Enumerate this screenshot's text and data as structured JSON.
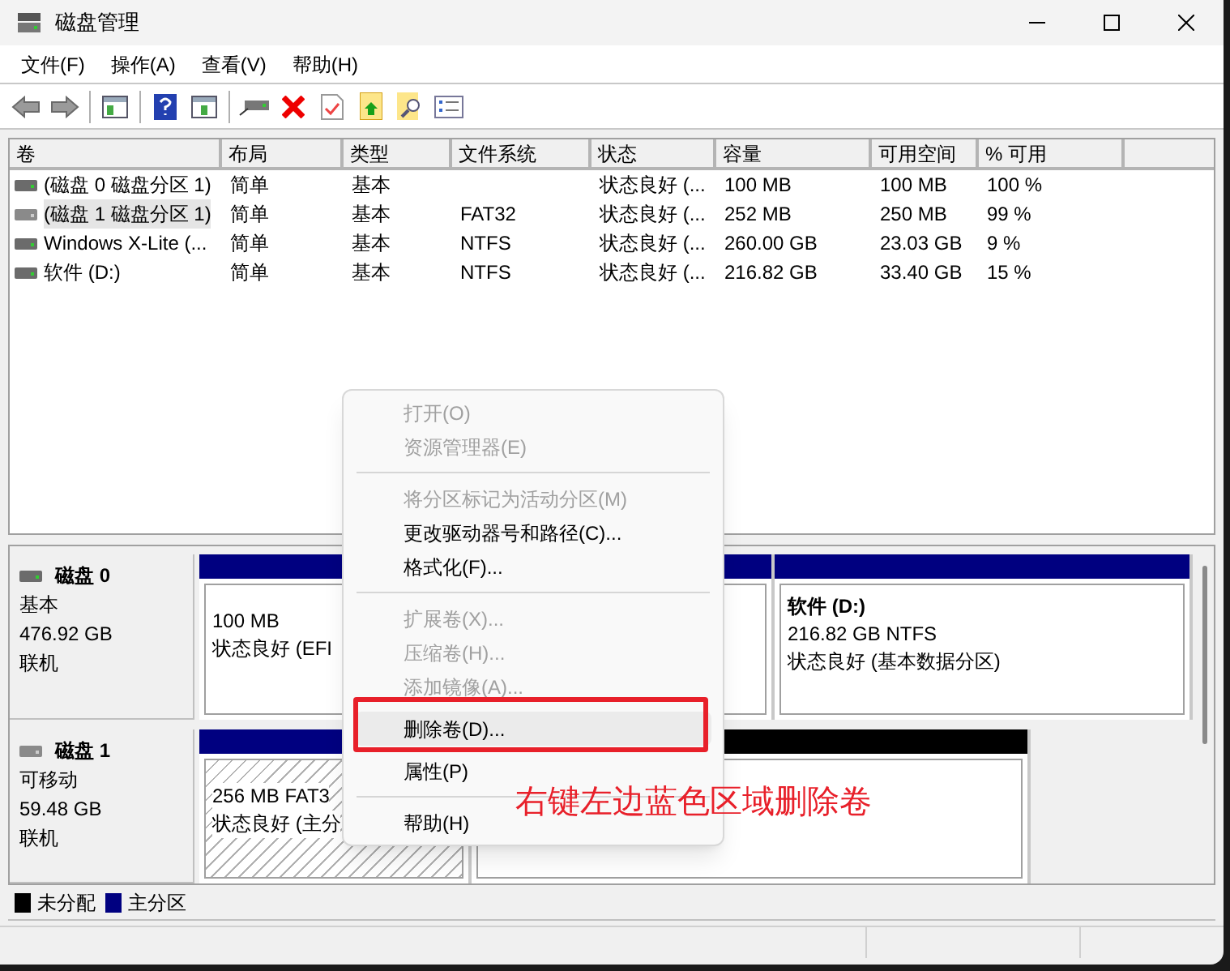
{
  "window": {
    "title": "磁盘管理"
  },
  "menu_bar": [
    "文件(F)",
    "操作(A)",
    "查看(V)",
    "帮助(H)"
  ],
  "table": {
    "columns": [
      "卷",
      "布局",
      "类型",
      "文件系统",
      "状态",
      "容量",
      "可用空间",
      "% 可用"
    ],
    "rows": [
      {
        "selected": false,
        "cells": [
          "(磁盘 0 磁盘分区 1)",
          "简单",
          "基本",
          "",
          "状态良好 (...",
          "100 MB",
          "100 MB",
          "100 %"
        ]
      },
      {
        "selected": true,
        "cells": [
          "(磁盘 1 磁盘分区 1)",
          "简单",
          "基本",
          "FAT32",
          "状态良好 (...",
          "252 MB",
          "250 MB",
          "99 %"
        ]
      },
      {
        "selected": false,
        "cells": [
          "Windows X-Lite (...",
          "简单",
          "基本",
          "NTFS",
          "状态良好 (...",
          "260.00 GB",
          "23.03 GB",
          "9 %"
        ]
      },
      {
        "selected": false,
        "cells": [
          "软件 (D:)",
          "简单",
          "基本",
          "NTFS",
          "状态良好 (...",
          "216.82 GB",
          "33.40 GB",
          "15 %"
        ]
      }
    ]
  },
  "disks": [
    {
      "name": "磁盘 0",
      "type": "基本",
      "size": "476.92 GB",
      "status": "联机",
      "partitions": [
        {
          "kind": "primary",
          "selected": false,
          "lines": [
            "100 MB",
            "状态良好 (EFI"
          ]
        },
        {
          "kind": "primary",
          "selected": false
        },
        {
          "kind": "primary",
          "selected": false,
          "title": "软件  (D:)",
          "lines": [
            "216.82 GB NTFS",
            "状态良好 (基本数据分区)"
          ]
        }
      ]
    },
    {
      "name": "磁盘 1",
      "type": "可移动",
      "size": "59.48 GB",
      "status": "联机",
      "partitions": [
        {
          "kind": "primary",
          "selected": true,
          "lines": [
            "256 MB FAT3",
            "状态良好 (主分"
          ]
        },
        {
          "kind": "unallocated",
          "selected": false
        }
      ]
    }
  ],
  "legend": [
    {
      "label": "未分配",
      "color": "#000000"
    },
    {
      "label": "主分区",
      "color": "#000080"
    }
  ],
  "context_menu": [
    {
      "kind": "item",
      "label": "打开(O)",
      "disabled": true,
      "selected": false
    },
    {
      "kind": "item",
      "label": "资源管理器(E)",
      "disabled": true,
      "selected": false
    },
    {
      "kind": "separator"
    },
    {
      "kind": "item",
      "label": "将分区标记为活动分区(M)",
      "disabled": true,
      "selected": false
    },
    {
      "kind": "item",
      "label": "更改驱动器号和路径(C)...",
      "disabled": false,
      "selected": false
    },
    {
      "kind": "item",
      "label": "格式化(F)...",
      "disabled": false,
      "selected": false
    },
    {
      "kind": "separator"
    },
    {
      "kind": "item",
      "label": "扩展卷(X)...",
      "disabled": true,
      "selected": false
    },
    {
      "kind": "item",
      "label": "压缩卷(H)...",
      "disabled": true,
      "selected": false
    },
    {
      "kind": "item",
      "label": "添加镜像(A)...",
      "disabled": true,
      "selected": false
    },
    {
      "kind": "item",
      "label": "删除卷(D)...",
      "disabled": false,
      "selected": true
    },
    {
      "kind": "item",
      "label": "属性(P)",
      "disabled": false,
      "selected": false
    },
    {
      "kind": "separator"
    },
    {
      "kind": "item",
      "label": "帮助(H)",
      "disabled": false,
      "selected": false
    }
  ],
  "annotation": {
    "text": "右键左边蓝色区域删除卷"
  }
}
